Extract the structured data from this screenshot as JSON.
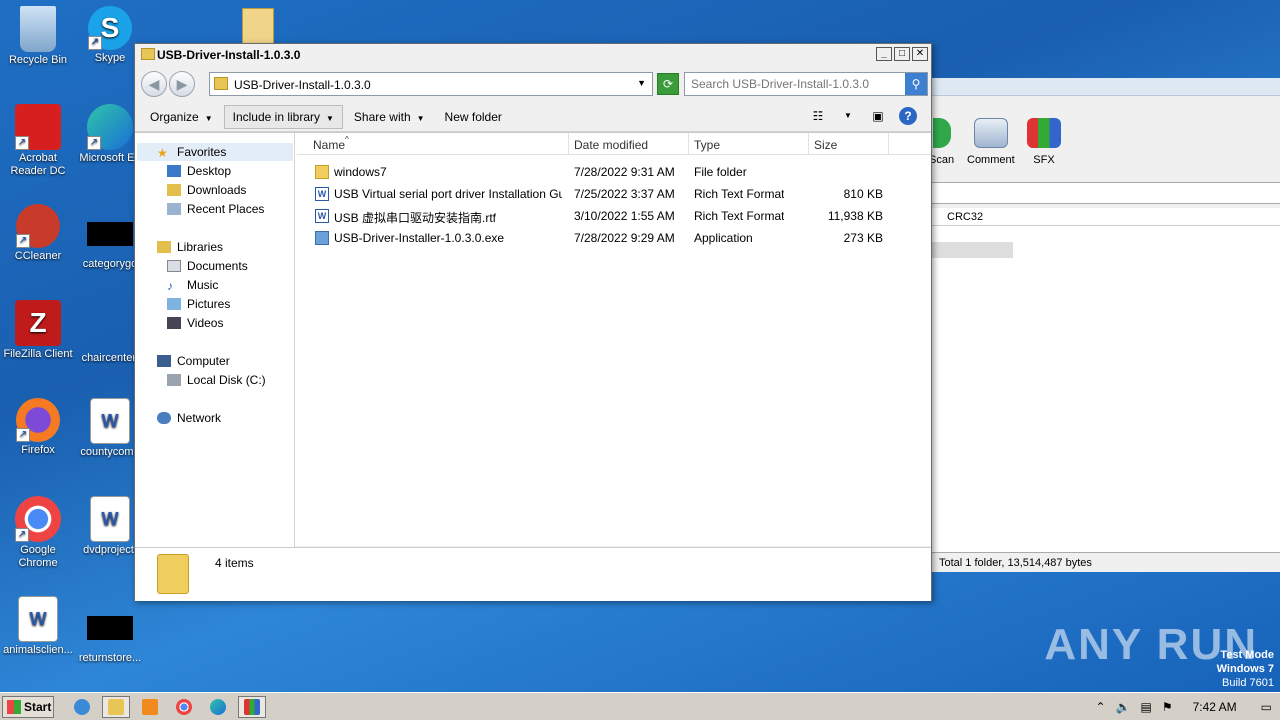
{
  "desktop": {
    "icons": [
      {
        "label": "Recycle Bin"
      },
      {
        "label": "Skype"
      },
      {
        "label": "Acrobat Reader DC"
      },
      {
        "label": "Microsoft Ed"
      },
      {
        "label": "CCleaner"
      },
      {
        "label": "categorygo"
      },
      {
        "label": "FileZilla Client"
      },
      {
        "label": "chaircenter."
      },
      {
        "label": "Firefox"
      },
      {
        "label": "countycome"
      },
      {
        "label": "Google Chrome"
      },
      {
        "label": "dvdproject."
      },
      {
        "label": "animalsclien..."
      },
      {
        "label": "returnstore..."
      }
    ]
  },
  "winrar": {
    "toolbar": [
      {
        "label": "Scan"
      },
      {
        "label": "Comment"
      },
      {
        "label": "SFX"
      }
    ],
    "column": "CRC32",
    "status": "Total 1 folder, 13,514,487 bytes"
  },
  "explorer": {
    "title": "USB-Driver-Install-1.0.3.0",
    "address": "USB-Driver-Install-1.0.3.0",
    "search_placeholder": "Search USB-Driver-Install-1.0.3.0",
    "commands": {
      "organize": "Organize",
      "include": "Include in library",
      "share": "Share with",
      "new_folder": "New folder"
    },
    "nav": {
      "favorites": "Favorites",
      "desktop": "Desktop",
      "downloads": "Downloads",
      "recent": "Recent Places",
      "libraries": "Libraries",
      "documents": "Documents",
      "music": "Music",
      "pictures": "Pictures",
      "videos": "Videos",
      "computer": "Computer",
      "localdisk": "Local Disk (C:)",
      "network": "Network"
    },
    "columns": {
      "name": "Name",
      "date": "Date modified",
      "type": "Type",
      "size": "Size"
    },
    "files": [
      {
        "name": "windows7",
        "date": "7/28/2022 9:31 AM",
        "type": "File folder",
        "size": ""
      },
      {
        "name": "USB Virtual serial port driver Installation Guid...",
        "date": "7/25/2022 3:37 AM",
        "type": "Rich Text Format",
        "size": "810 KB"
      },
      {
        "name": "USB 虚拟串口驱动安装指南.rtf",
        "date": "3/10/2022 1:55 AM",
        "type": "Rich Text Format",
        "size": "11,938 KB"
      },
      {
        "name": "USB-Driver-Installer-1.0.3.0.exe",
        "date": "7/28/2022 9:29 AM",
        "type": "Application",
        "size": "273 KB"
      }
    ],
    "status": "4 items"
  },
  "taskbar": {
    "start": "Start",
    "clock": "7:42 AM"
  },
  "watermark": {
    "brand": "ANY RUN",
    "line1": "Test Mode",
    "line2": "Windows 7",
    "line3": "Build 7601"
  }
}
